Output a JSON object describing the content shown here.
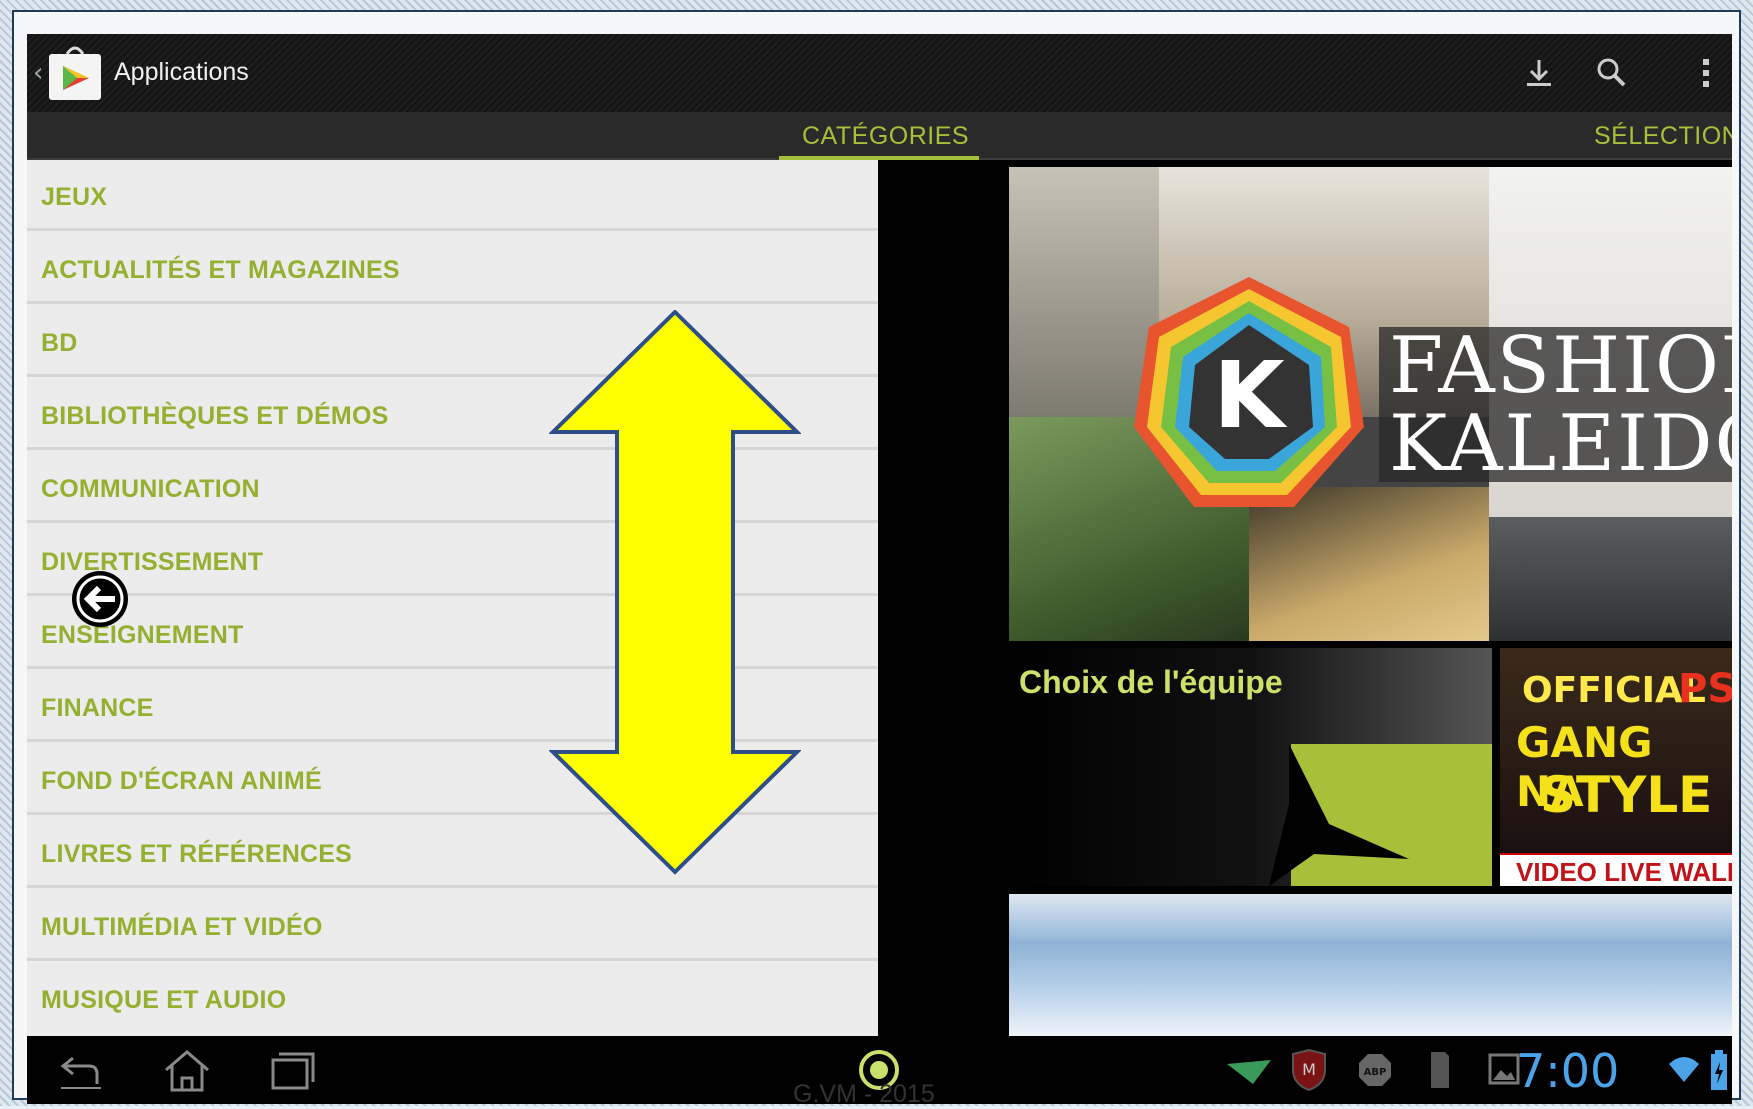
{
  "action_bar": {
    "title": "Applications",
    "icons": [
      "back-caret-icon",
      "play-store-icon",
      "download-icon",
      "search-icon",
      "overflow-menu-icon"
    ]
  },
  "tabs": [
    {
      "label": "CATÉGORIES",
      "active": true
    },
    {
      "label": "SÉLECTION",
      "active": false
    }
  ],
  "categories": [
    "JEUX",
    "ACTUALITÉS ET MAGAZINES",
    "BD",
    "BIBLIOTHÈQUES ET DÉMOS",
    "COMMUNICATION",
    "DIVERTISSEMENT",
    "ENSEIGNEMENT",
    "FINANCE",
    "FOND D'ÉCRAN ANIMÉ",
    "LIVRES ET RÉFÉRENCES",
    "MULTIMÉDIA ET VIDÉO",
    "MUSIQUE ET AUDIO"
  ],
  "featured": {
    "banner_letter": "K",
    "banner_line1": "FASHION",
    "banner_line2": "KALEIDOS",
    "editors_choice": "Choix de l'équipe",
    "psy_line1": "OFFICIAL",
    "psy_line1b": "PS",
    "psy_line2": "GANG NA",
    "psy_line3": "STYLE",
    "psy_bar": "VIDEO LIVE WALL"
  },
  "status_bar": {
    "time": "7:00",
    "icons": [
      "notification-icon",
      "mcafee-icon",
      "adblock-icon",
      "sd-card-icon",
      "gallery-icon",
      "wifi-icon",
      "battery-icon"
    ]
  },
  "nav_bar": {
    "icons": [
      "back-icon",
      "home-icon",
      "recent-apps-icon",
      "center-circle-icon"
    ]
  },
  "watermark": "G.VM - 2015",
  "colors": {
    "accent_green": "#93b030",
    "tab_green": "#a6c03a",
    "arrow_yellow": "#ffff00",
    "clock_blue": "#4da3e8"
  }
}
